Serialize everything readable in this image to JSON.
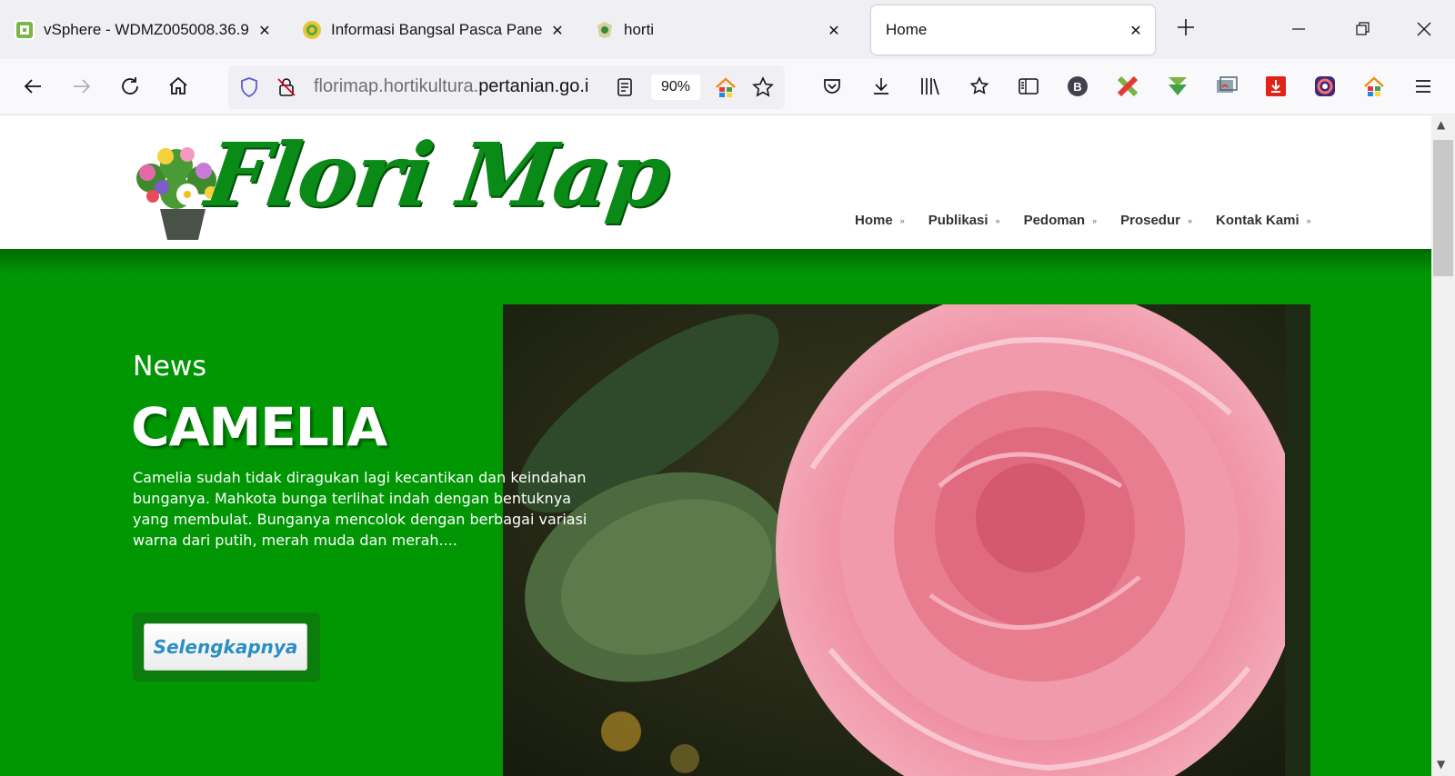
{
  "browser": {
    "tabs": [
      {
        "title": "vSphere - WDMZ005008.36.9",
        "active": false
      },
      {
        "title": "Informasi Bangsal Pasca Pane",
        "active": false
      },
      {
        "title": "horti",
        "active": false
      },
      {
        "title": "Home",
        "active": true
      }
    ],
    "url": {
      "prefix": "florimap.hortikultura.",
      "domain": "pertanian.go.i"
    },
    "zoom": "90%",
    "extensions": [
      "b-badge-icon",
      "tools-icon",
      "download-arrow-icon",
      "screenshot-icon",
      "pdf-icon",
      "camera-icon",
      "home-colorful-icon"
    ]
  },
  "site": {
    "logo_text": "Flori Map",
    "nav": [
      "Home",
      "Publikasi",
      "Pedoman",
      "Prosedur",
      "Kontak Kami"
    ],
    "hero": {
      "label": "News",
      "title": "CAMELIA",
      "description": "Camelia sudah tidak diragukan lagi kecantikan dan keindahan bunganya. Mahkota bunga terlihat indah dengan bentuknya yang membulat. Bunganya mencolok dengan berbagai variasi warna dari putih, merah muda dan merah....",
      "button": "Selengkapnya"
    }
  },
  "colors": {
    "brand_green": "#009604",
    "logo_green": "#0a8a16",
    "button_text": "#2a8fc4"
  }
}
